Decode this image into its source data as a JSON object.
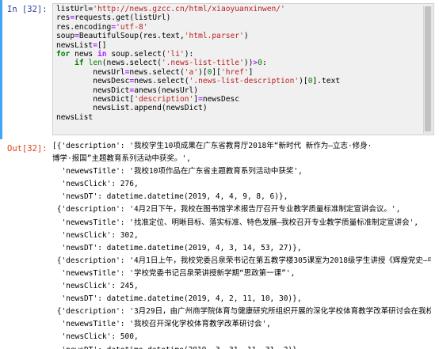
{
  "input_prompt": "In [32]:",
  "output_prompt": "Out[32]:",
  "code_lines": [
    [
      {
        "t": "listUrl="
      },
      {
        "t": "'http://news.gzcc.cn/html/xiaoyuanxinwen/'",
        "c": "st"
      }
    ],
    [
      {
        "t": "res"
      },
      {
        "t": "=",
        "c": "op"
      },
      {
        "t": "requests.get(listUrl)"
      }
    ],
    [
      {
        "t": "res.encoding"
      },
      {
        "t": "=",
        "c": "op"
      },
      {
        "t": "'utf-8'",
        "c": "st"
      }
    ],
    [
      {
        "t": "soup"
      },
      {
        "t": "=",
        "c": "op"
      },
      {
        "t": "BeautifulSoup(res.text,"
      },
      {
        "t": "'html.parser'",
        "c": "st"
      },
      {
        "t": ")"
      }
    ],
    [
      {
        "t": "newsList"
      },
      {
        "t": "=",
        "c": "op"
      },
      {
        "t": "[]"
      }
    ],
    [
      {
        "t": "for",
        "c": "kw"
      },
      {
        "t": " news "
      },
      {
        "t": "in",
        "c": "op"
      },
      {
        "t": " soup.select("
      },
      {
        "t": "'li'",
        "c": "st"
      },
      {
        "t": "):"
      }
    ],
    [
      {
        "t": "    "
      },
      {
        "t": "if",
        "c": "kw"
      },
      {
        "t": " "
      },
      {
        "t": "len",
        "c": "bi"
      },
      {
        "t": "(news.select("
      },
      {
        "t": "'.news-list-title'",
        "c": "st"
      },
      {
        "t": "))"
      },
      {
        "t": ">",
        "c": "op"
      },
      {
        "t": "0",
        "c": "nu"
      },
      {
        "t": ":"
      }
    ],
    [
      {
        "t": "        newsUrl"
      },
      {
        "t": "=",
        "c": "op"
      },
      {
        "t": "news.select("
      },
      {
        "t": "'a'",
        "c": "st"
      },
      {
        "t": ")["
      },
      {
        "t": "0",
        "c": "nu"
      },
      {
        "t": "]["
      },
      {
        "t": "'href'",
        "c": "st"
      },
      {
        "t": "]"
      }
    ],
    [
      {
        "t": "        newsDesc"
      },
      {
        "t": "=",
        "c": "op"
      },
      {
        "t": "news.select("
      },
      {
        "t": "'.news-list-description'",
        "c": "st"
      },
      {
        "t": ")["
      },
      {
        "t": "0",
        "c": "nu"
      },
      {
        "t": "].text"
      }
    ],
    [
      {
        "t": "        newsDict"
      },
      {
        "t": "=",
        "c": "op"
      },
      {
        "t": "anews(newsUrl)"
      }
    ],
    [
      {
        "t": "        newsDict["
      },
      {
        "t": "'description'",
        "c": "st"
      },
      {
        "t": "]"
      },
      {
        "t": "=",
        "c": "op"
      },
      {
        "t": "newsDesc"
      }
    ],
    [
      {
        "t": "        newsList.append(newsDict)"
      }
    ],
    [
      {
        "t": "newsList"
      }
    ]
  ],
  "output_lines": [
    "[{'description': '我校学生10项成果在广东省教育厅2018年“新时代 新作为—立志·修身·",
    "博学·报国”主题教育系列活动中获奖。',",
    "  'newewsTitle': '我校10项作品在广东省主题教育系列活动中获奖',",
    "  'newsClick': 276,",
    "  'newsDT': datetime.datetime(2019, 4, 4, 9, 8, 6)},",
    " {'description': '4月2日下午，我校在图书馆学术报告厅召开专业教学质量标准制定宣讲会议。',",
    "  'newewsTitle': '找准定位、明晰目标、落实标准、特色发展—我校召开专业教学质量标准制定宣讲会',",
    "  'newsClick': 302,",
    "  'newsDT': datetime.datetime(2019, 4, 3, 14, 53, 27)},",
    " {'description': '4月1日上午，我校党委吕泉荣书记在第五教学楼305课室为2018级学生讲授《辉煌党史—中国共产党的光辉历程》。',",
    "  'newewsTitle': '学校党委书记吕泉荣讲授新学期“思政第一课”',",
    "  'newsClick': 245,",
    "  'newsDT': datetime.datetime(2019, 4, 2, 11, 10, 30)},",
    " {'description': '3月29日，由广州商学院体育与健康研究所组织开展的深化学校体育教学改革研讨会在我校学术交流中心召开。',",
    "  'newewsTitle': '我校召开深化学校体育教学改革研讨会',",
    "  'newsClick': 500,",
    "  'newsDT': datetime.datetime(2019, 3, 31, 11, 31, 2)},"
  ],
  "colors": {
    "input_prompt": "#303f9f",
    "output_prompt": "#d84315",
    "cell_background": "#f0f0f0",
    "selection_bar": "#42a5f5"
  }
}
